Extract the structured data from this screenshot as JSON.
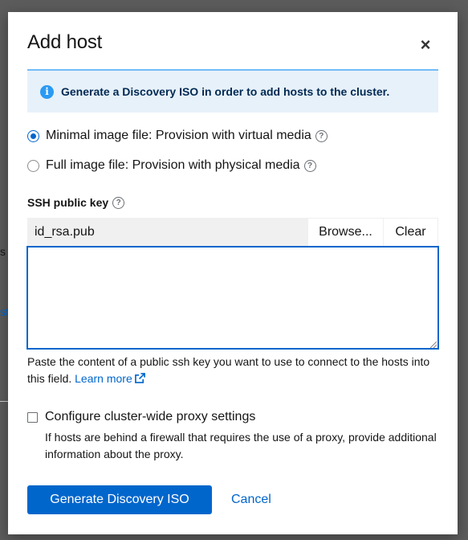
{
  "background": {
    "fragment_1": "s",
    "fragment_2": "st"
  },
  "modal": {
    "title": "Add host",
    "close_glyph": "×"
  },
  "alert": {
    "icon": "info-icon",
    "icon_glyph": "i",
    "text": "Generate a Discovery ISO in order to add hosts to the cluster."
  },
  "image_type": {
    "options": [
      {
        "label": "Minimal image file: Provision with virtual media",
        "selected": true
      },
      {
        "label": "Full image file: Provision with physical media",
        "selected": false
      }
    ]
  },
  "ssh": {
    "label": "SSH public key",
    "file_name": "id_rsa.pub",
    "browse_label": "Browse...",
    "clear_label": "Clear",
    "value": "",
    "helper_text": "Paste the content of a public ssh key you want to use to connect to the hosts into this field.",
    "learn_more": "Learn more"
  },
  "proxy": {
    "checked": false,
    "label": "Configure cluster-wide proxy settings",
    "description": "If hosts are behind a firewall that requires the use of a proxy, provide additional information about the proxy."
  },
  "footer": {
    "primary_label": "Generate Discovery ISO",
    "cancel_label": "Cancel"
  },
  "colors": {
    "primary": "#0066cc",
    "alert_bg": "#e7f1fa",
    "alert_border": "#73bcf7",
    "alert_text": "#002952"
  }
}
